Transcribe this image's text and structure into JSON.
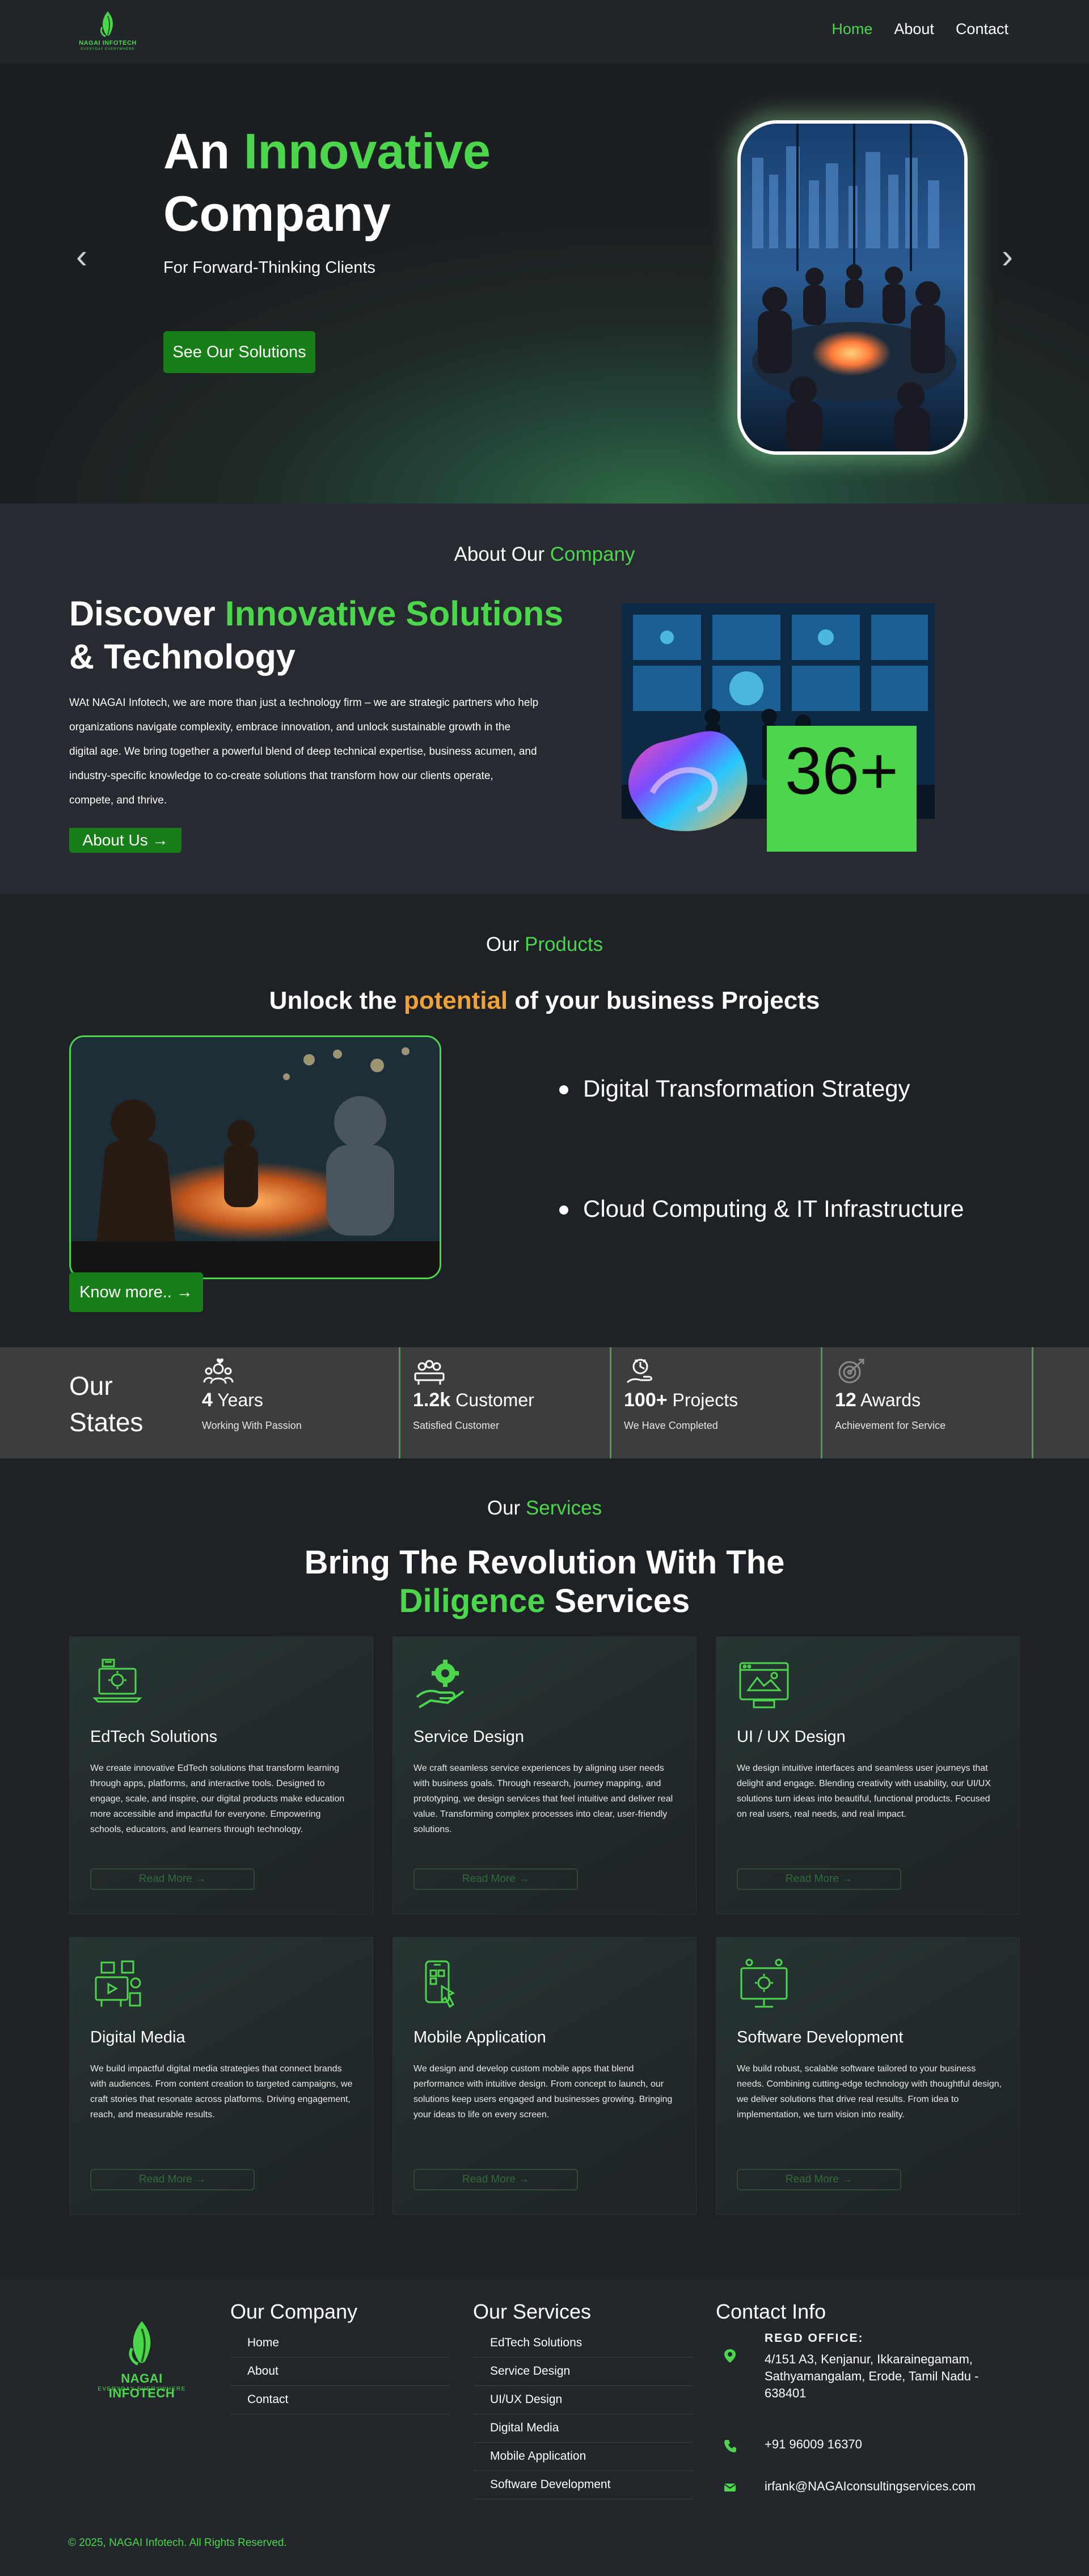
{
  "nav": {
    "logo": {
      "name": "NAGAI INFOTECH",
      "tagline": "EVERYDAY EVERYWHERE"
    },
    "links": [
      "Home",
      "About",
      "Contact"
    ]
  },
  "hero": {
    "title_line1_plain": "An ",
    "title_line1_accent": "Innovative",
    "title_line2": "Company",
    "subtitle": "For Forward-Thinking Clients",
    "cta": "See Our Solutions",
    "prev_arrow": "‹",
    "next_arrow": "›"
  },
  "about": {
    "kicker_plain": "About Our ",
    "kicker_accent": "Company",
    "title_plain1": "Discover ",
    "title_accent": "Innovative Solutions",
    "title_plain2": "& Technology",
    "text": "WAt NAGAI Infotech, we are more than just a technology firm – we are strategic partners who help organizations navigate complexity, embrace innovation, and unlock sustainable growth in the digital age. We bring together a powerful blend of deep technical expertise, business acumen, and industry-specific knowledge to co-create solutions that transform how our clients operate, compete, and thrive.",
    "button": "About Us →",
    "stat": "36+"
  },
  "products": {
    "kicker_plain": "Our ",
    "kicker_accent": "Products",
    "title_plain1": "Unlock the ",
    "title_accent": "potential",
    "title_plain2": " of your business Projects",
    "items": [
      "Digital Transformation Strategy",
      "Cloud Computing & IT Infrastructure"
    ],
    "button": "Know more.. →"
  },
  "states": {
    "label_line1": "Our",
    "label_line2": "States",
    "items": [
      {
        "num": "4",
        "unit": " Years",
        "desc": "Working With Passion"
      },
      {
        "num": "1.2k",
        "unit": " Customer",
        "desc": "Satisfied Customer"
      },
      {
        "num": "100+",
        "unit": " Projects",
        "desc": "We Have Completed"
      },
      {
        "num": "12",
        "unit": " Awards",
        "desc": "Achievement for Service"
      }
    ]
  },
  "services": {
    "kicker_plain": "Our ",
    "kicker_accent": "Services",
    "title_line1": "Bring The Revolution With The",
    "title_accent": "Diligence",
    "title_line2_rest": " Services",
    "cards": [
      {
        "title": "EdTech Solutions",
        "text": "We create innovative EdTech solutions that transform learning through apps, platforms, and interactive tools. Designed to engage, scale, and inspire, our digital products make education more accessible and impactful for everyone. Empowering schools, educators, and learners through technology.",
        "button": "Read More →",
        "icon": "laptop-gear-icon"
      },
      {
        "title": "Service Design",
        "text": "We craft seamless service experiences by aligning user needs with business goals. Through research, journey mapping, and prototyping, we design services that feel intuitive and deliver real value. Transforming complex processes into clear, user-friendly solutions.",
        "button": "Read More →",
        "icon": "hand-gear-icon"
      },
      {
        "title": "UI / UX Design",
        "text": "We design intuitive interfaces and seamless user journeys that delight and engage. Blending creativity with usability, our UI/UX solutions turn ideas into beautiful, functional products. Focused on real users, real needs, and real impact.",
        "button": "Read More →",
        "icon": "browser-design-icon"
      },
      {
        "title": "Digital Media",
        "text": "We build impactful digital media strategies that connect brands with audiences. From content creation to targeted campaigns, we craft stories that resonate across platforms. Driving engagement, reach, and measurable results.",
        "button": "Read More →",
        "icon": "media-icon"
      },
      {
        "title": "Mobile Application",
        "text": "We design and develop custom mobile apps that blend performance with intuitive design. From concept to launch, our solutions keep users engaged and businesses growing. Bringing your ideas to life on every screen.",
        "button": "Read More →",
        "icon": "mobile-app-icon"
      },
      {
        "title": "Software Development",
        "text": "We build robust, scalable software tailored to your business needs. Combining cutting-edge technology with thoughtful design, we deliver solutions that drive real results. From idea to implementation, we turn vision into reality.",
        "button": "Read More →",
        "icon": "monitor-gear-icon"
      }
    ]
  },
  "footer": {
    "logo": {
      "name": "NAGAI INFOTECH",
      "tagline": "EVERYDAY EVERYWHERE"
    },
    "company_title": "Our Company",
    "company_links": [
      "Home",
      "About",
      "Contact"
    ],
    "services_title": "Our Services",
    "services_links": [
      "EdTech Solutions",
      "Service Design",
      "UI/UX Design",
      "Digital Media",
      "Mobile Application",
      "Software Development"
    ],
    "contact_title": "Contact Info",
    "regd_label": "REGD OFFICE:",
    "address": "4/151 A3, Kenjanur, Ikkarainegamam, Sathyamangalam, Erode, Tamil Nadu - 638401",
    "phone": "+91 96009 16370",
    "email": "irfank@NAGAIconsultingservices.com",
    "copyright": "© 2025, NAGAI Infotech. All Rights Reserved."
  },
  "colors": {
    "accent_green": "#4cd64c",
    "button_green": "#187f18",
    "accent_orange": "#f0a23a",
    "background": "#1e2126"
  }
}
